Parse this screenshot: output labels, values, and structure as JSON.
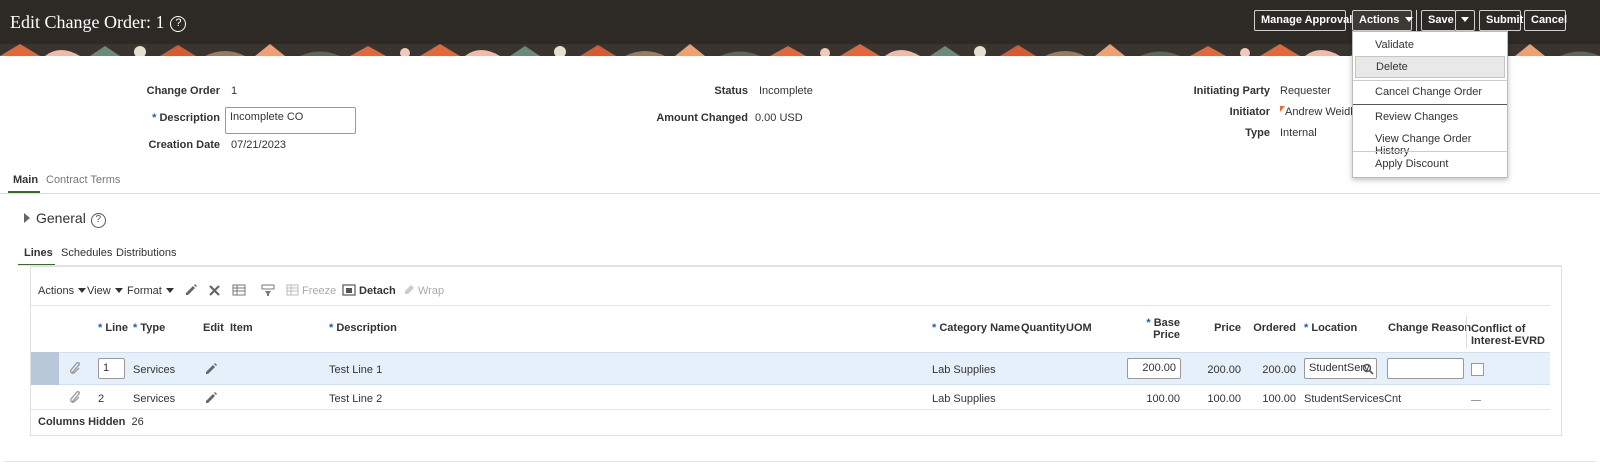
{
  "header": {
    "title": "Edit Change Order: 1",
    "help": "?",
    "buttons": {
      "manage_approvals": "Manage Approvals",
      "actions": "Actions",
      "save": "Save",
      "submit": "Submit",
      "cancel": "Cancel"
    }
  },
  "actions_menu": {
    "items": [
      "Validate",
      "Delete",
      "Cancel Change Order",
      "Review Changes",
      "View Change Order History",
      "Apply Discount"
    ],
    "highlighted": "Delete"
  },
  "info": {
    "change_order_label": "Change Order",
    "change_order_value": "1",
    "description_label": "Description",
    "description_value": "Incomplete CO",
    "creation_date_label": "Creation Date",
    "creation_date_value": "07/21/2023",
    "status_label": "Status",
    "status_value": "Incomplete",
    "amount_changed_label": "Amount Changed",
    "amount_changed_value": "0.00",
    "amount_currency": "USD",
    "initiating_party_label": "Initiating Party",
    "initiating_party_value": "Requester",
    "initiator_label": "Initiator",
    "initiator_value": "Andrew Weidler",
    "type_label": "Type",
    "type_value": "Internal",
    "required_mark": "*"
  },
  "tabs": [
    "Main",
    "Contract Terms"
  ],
  "general": {
    "title": "General",
    "help": "?"
  },
  "subtabs": [
    "Lines",
    "Schedules",
    "Distributions"
  ],
  "toolbar": {
    "actions": "Actions",
    "view": "View",
    "format": "Format",
    "freeze": "Freeze",
    "detach": "Detach",
    "wrap": "Wrap"
  },
  "table": {
    "headers": {
      "line": "Line",
      "type": "Type",
      "edit": "Edit",
      "item": "Item",
      "description": "Description",
      "category_name": "Category Name",
      "quantity": "Quantity",
      "uom": "UOM",
      "base_price_1": "Base",
      "base_price_2": "Price",
      "price": "Price",
      "ordered": "Ordered",
      "location": "Location",
      "change_reason": "Change Reason",
      "conflict_1": "Conflict of",
      "conflict_2": "Interest-EVRD"
    },
    "rows": [
      {
        "line": "1",
        "type": "Services",
        "description": "Test Line 1",
        "category": "Lab Supplies",
        "base_price": "200.00",
        "price": "200.00",
        "ordered": "200.00",
        "location": "StudentServ"
      },
      {
        "line": "2",
        "type": "Services",
        "description": "Test Line 2",
        "category": "Lab Supplies",
        "base_price": "100.00",
        "price": "100.00",
        "ordered": "100.00",
        "location": "StudentServicesCnt"
      }
    ],
    "columns_hidden_label": "Columns Hidden",
    "columns_hidden_value": "26"
  }
}
